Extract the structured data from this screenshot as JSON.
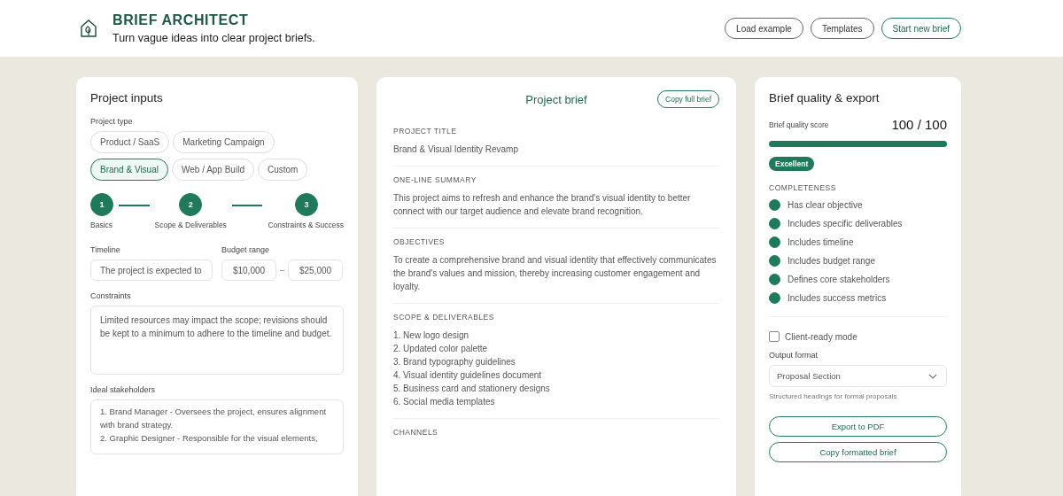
{
  "header": {
    "title": "BRIEF ARCHITECT",
    "tagline": "Turn vague ideas into clear project briefs.",
    "buttons": [
      {
        "label": "Load example",
        "kind": "plain"
      },
      {
        "label": "Templates",
        "kind": "plain"
      },
      {
        "label": "Start new brief",
        "kind": "primary"
      }
    ]
  },
  "inputs": {
    "title": "Project inputs",
    "project_type_label": "Project type",
    "project_types": [
      {
        "label": "Product / SaaS",
        "selected": false
      },
      {
        "label": "Marketing Campaign",
        "selected": false
      },
      {
        "label": "Brand & Visual",
        "selected": true
      },
      {
        "label": "Web / App Build",
        "selected": false
      },
      {
        "label": "Custom",
        "selected": false
      }
    ],
    "steps": [
      {
        "number": "1",
        "label": "Basics",
        "completed": true
      },
      {
        "number": "2",
        "label": "Scope & Deliverables",
        "completed": true
      },
      {
        "number": "3",
        "label": "Constraints & Success",
        "completed": true
      }
    ],
    "timeline": {
      "label": "Timeline",
      "value": "The project is expected to"
    },
    "budget": {
      "label": "Budget range",
      "min": "$10,000",
      "separator": "–",
      "max": "$25,000"
    },
    "constraints": {
      "label": "Constraints",
      "value": "Limited resources may impact the scope; revisions should be kept to a minimum to adhere to the timeline and budget."
    },
    "stakeholders": {
      "label": "Ideal stakeholders",
      "value": "1. Brand Manager - Oversees the project, ensures alignment with brand strategy.\n2. Graphic Designer - Responsible for the visual elements,"
    }
  },
  "brief": {
    "title": "Project brief",
    "copy_button": "Copy full brief",
    "sections": [
      {
        "heading": "PROJECT TITLE",
        "kind": "text",
        "text": "Brand & Visual Identity Revamp"
      },
      {
        "heading": "ONE-LINE SUMMARY",
        "kind": "text",
        "text": "This project aims to refresh and enhance the brand's visual identity to better connect with our target audience and elevate brand recognition."
      },
      {
        "heading": "OBJECTIVES",
        "kind": "text",
        "text": "To create a comprehensive brand and visual identity that effectively communicates the brand's values and mission, thereby increasing customer engagement and loyalty."
      },
      {
        "heading": "SCOPE & DELIVERABLES",
        "kind": "list",
        "items": [
          "1. New logo design",
          "2. Updated color palette",
          "3. Brand typography guidelines",
          "4. Visual identity guidelines document",
          "5. Business card and stationery designs",
          "6. Social media templates"
        ]
      },
      {
        "heading": "CHANNELS",
        "kind": "text"
      }
    ]
  },
  "quality": {
    "title": "Brief quality & export",
    "score_label": "Brief quality score",
    "score": "100 / 100",
    "level": 1.0,
    "badge": "Excellent",
    "completeness_heading": "COMPLETENESS",
    "checks": [
      {
        "label": "Has clear objective",
        "checked": true
      },
      {
        "label": "Includes specific deliverables",
        "checked": true
      },
      {
        "label": "Includes timeline",
        "checked": true
      },
      {
        "label": "Includes budget range",
        "checked": true
      },
      {
        "label": "Defines core stakeholders",
        "checked": true
      },
      {
        "label": "Includes success metrics",
        "checked": true
      }
    ],
    "client_ready": {
      "label": "Client-ready mode",
      "checked": false
    },
    "output_format": {
      "label": "Output format",
      "value": "Proposal Section",
      "hint": "Structured headings for formal proposals"
    },
    "buttons": [
      "Export to PDF",
      "Copy formatted brief"
    ]
  }
}
